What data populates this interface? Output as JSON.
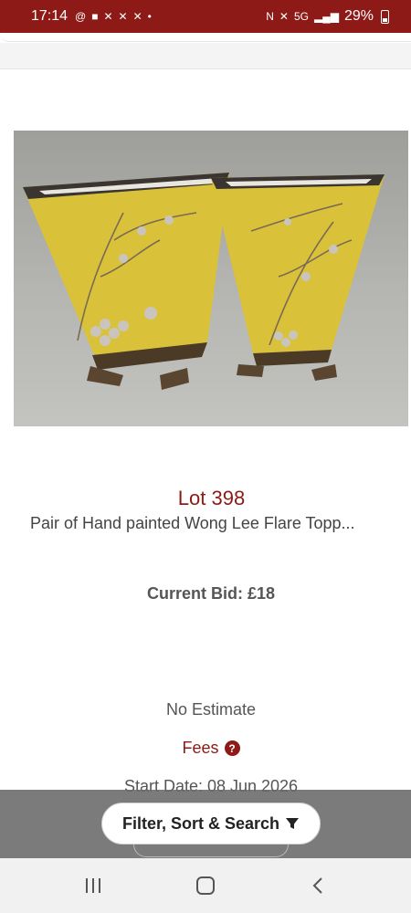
{
  "status_bar": {
    "time": "17:14",
    "network": "5G",
    "battery": "29%",
    "icons": [
      "threads-icon",
      "chat-icon",
      "app-icon",
      "app-icon",
      "app-icon",
      "dot-icon",
      "nfc-icon",
      "mute-icon",
      "signal-icon",
      "battery-icon"
    ]
  },
  "lot": {
    "image_alt": "Pair of yellow hand painted flared planters with bronze feet",
    "number": "Lot 398",
    "title": "Pair of Hand painted Wong Lee Flare Topp...",
    "current_bid": "Current Bid: £18",
    "estimate": "No Estimate",
    "fees_label": "Fees",
    "start_date": "Start Date: 08 Jun 2026"
  },
  "filter_button": {
    "label": "Filter, Sort & Search"
  },
  "nav_bar": {
    "items": [
      "recents-icon",
      "home-icon",
      "back-icon"
    ]
  },
  "colors": {
    "brand": "#8d1a16",
    "overlay": "#696969",
    "text": "#555555"
  }
}
